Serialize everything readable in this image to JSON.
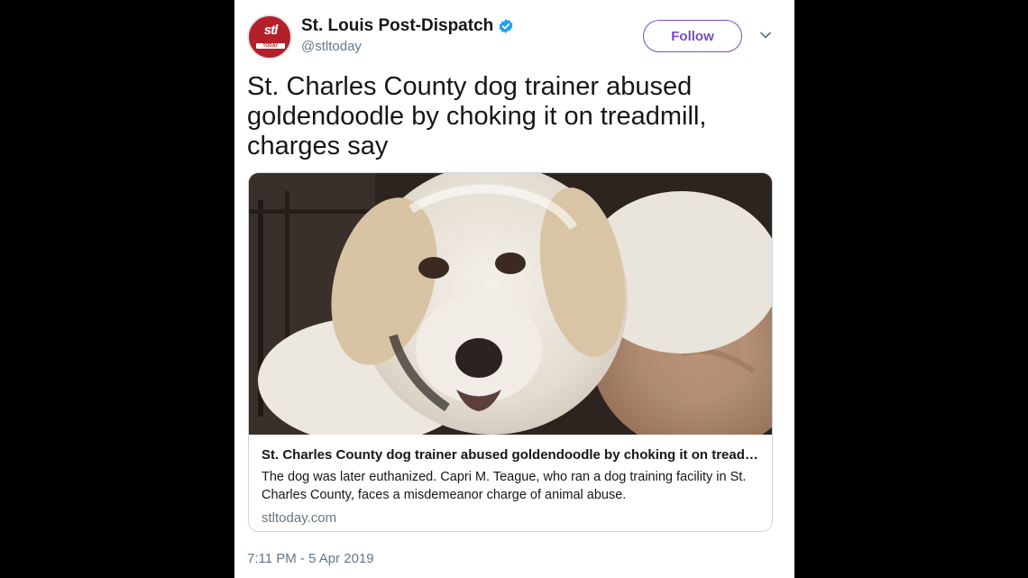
{
  "account": {
    "display_name": "St. Louis Post-Dispatch",
    "handle": "@stltoday",
    "avatar_logo_text": "stl",
    "avatar_sub_text": "TODAY",
    "verified": true
  },
  "actions": {
    "follow_label": "Follow"
  },
  "tweet": {
    "text": "St. Charles County dog trainer abused goldendoodle by choking it on treadmill, charges say",
    "timestamp": "7:11 PM - 5 Apr 2019"
  },
  "card": {
    "title": "St. Charles County dog trainer abused goldendoodle by choking it on treadmi...",
    "description": "The dog was later euthanized. Capri M. Teague, who ran a dog training facility in St. Charles County, faces a misdemeanor charge of animal abuse.",
    "domain": "stltoday.com"
  },
  "colors": {
    "follow_accent": "#794bc4",
    "verified_blue": "#1da1f2",
    "brand_red": "#b3202a",
    "secondary_text": "#657786"
  },
  "icons": [
    "verified-badge-icon",
    "chevron-down-icon"
  ]
}
